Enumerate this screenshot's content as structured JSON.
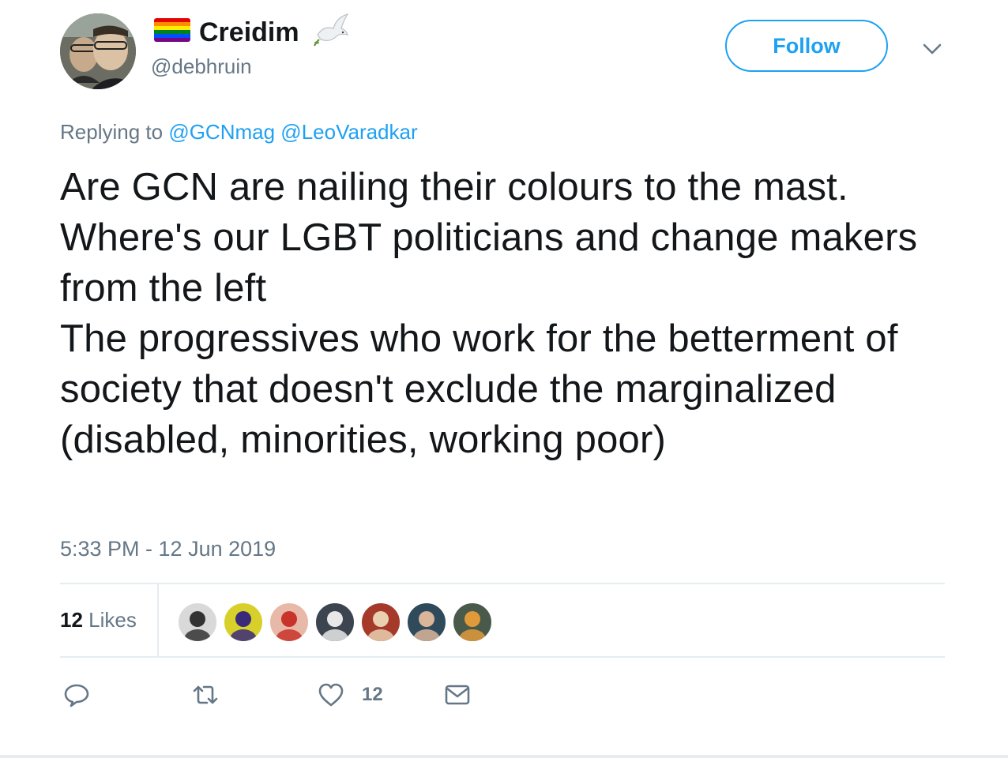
{
  "tweet": {
    "author": {
      "display_name": "Creidim",
      "handle": "@debhruin",
      "flag_colors": [
        "#e40303",
        "#ff8c00",
        "#ffed00",
        "#008026",
        "#004dff",
        "#750787"
      ]
    },
    "follow_label": "Follow",
    "replying_prefix": "Replying to",
    "replying_to": [
      "@GCNmag",
      "@LeoVaradkar"
    ],
    "text": "Are GCN are nailing their colours to the mast.\nWhere's our LGBT politicians and change makers from the left\nThe progressives who work for the betterment of society that doesn't exclude the marginalized (disabled, minorities, working poor)",
    "timestamp": "5:33 PM - 12 Jun 2019",
    "likes": {
      "count": "12",
      "label": "Likes"
    },
    "liker_avatars": [
      {
        "name": "liker-avatar-1",
        "bg": "#d9d9d9",
        "fg": "#333333"
      },
      {
        "name": "liker-avatar-2",
        "bg": "#d8d02a",
        "fg": "#3a2a7a"
      },
      {
        "name": "liker-avatar-3",
        "bg": "#e8b9a8",
        "fg": "#c8332a"
      },
      {
        "name": "liker-avatar-4",
        "bg": "#3c4450",
        "fg": "#e8e8e8"
      },
      {
        "name": "liker-avatar-5",
        "bg": "#a63a2a",
        "fg": "#e8d0b0"
      },
      {
        "name": "liker-avatar-6",
        "bg": "#2f4a5a",
        "fg": "#d9b59a"
      },
      {
        "name": "liker-avatar-7",
        "bg": "#4a5a4a",
        "fg": "#e09a3a"
      }
    ],
    "action_like_count": "12",
    "colors": {
      "accent": "#1da1f2",
      "secondary_text": "#657786",
      "divider": "#e6ecf0"
    }
  }
}
